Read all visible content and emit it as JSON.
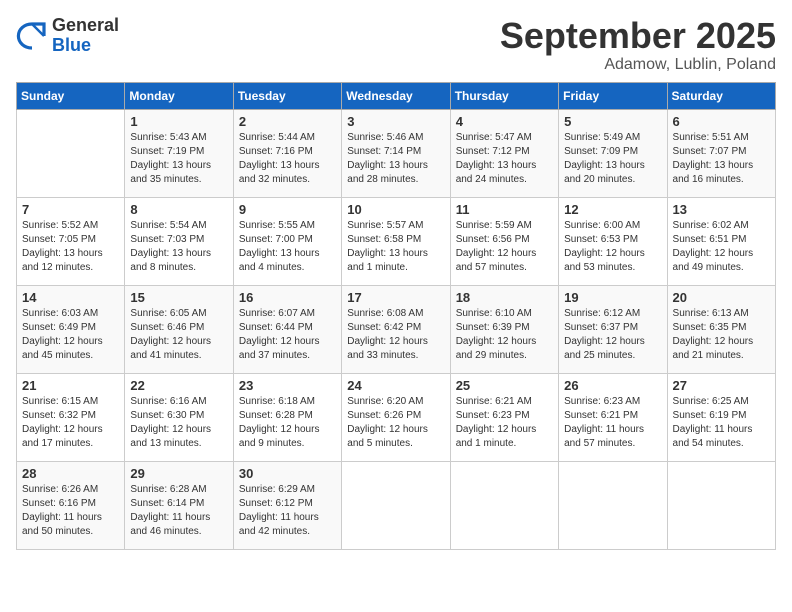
{
  "header": {
    "logo_general": "General",
    "logo_blue": "Blue",
    "month": "September 2025",
    "location": "Adamow, Lublin, Poland"
  },
  "days_of_week": [
    "Sunday",
    "Monday",
    "Tuesday",
    "Wednesday",
    "Thursday",
    "Friday",
    "Saturday"
  ],
  "weeks": [
    [
      {
        "num": "",
        "info": ""
      },
      {
        "num": "1",
        "info": "Sunrise: 5:43 AM\nSunset: 7:19 PM\nDaylight: 13 hours\nand 35 minutes."
      },
      {
        "num": "2",
        "info": "Sunrise: 5:44 AM\nSunset: 7:16 PM\nDaylight: 13 hours\nand 32 minutes."
      },
      {
        "num": "3",
        "info": "Sunrise: 5:46 AM\nSunset: 7:14 PM\nDaylight: 13 hours\nand 28 minutes."
      },
      {
        "num": "4",
        "info": "Sunrise: 5:47 AM\nSunset: 7:12 PM\nDaylight: 13 hours\nand 24 minutes."
      },
      {
        "num": "5",
        "info": "Sunrise: 5:49 AM\nSunset: 7:09 PM\nDaylight: 13 hours\nand 20 minutes."
      },
      {
        "num": "6",
        "info": "Sunrise: 5:51 AM\nSunset: 7:07 PM\nDaylight: 13 hours\nand 16 minutes."
      }
    ],
    [
      {
        "num": "7",
        "info": "Sunrise: 5:52 AM\nSunset: 7:05 PM\nDaylight: 13 hours\nand 12 minutes."
      },
      {
        "num": "8",
        "info": "Sunrise: 5:54 AM\nSunset: 7:03 PM\nDaylight: 13 hours\nand 8 minutes."
      },
      {
        "num": "9",
        "info": "Sunrise: 5:55 AM\nSunset: 7:00 PM\nDaylight: 13 hours\nand 4 minutes."
      },
      {
        "num": "10",
        "info": "Sunrise: 5:57 AM\nSunset: 6:58 PM\nDaylight: 13 hours\nand 1 minute."
      },
      {
        "num": "11",
        "info": "Sunrise: 5:59 AM\nSunset: 6:56 PM\nDaylight: 12 hours\nand 57 minutes."
      },
      {
        "num": "12",
        "info": "Sunrise: 6:00 AM\nSunset: 6:53 PM\nDaylight: 12 hours\nand 53 minutes."
      },
      {
        "num": "13",
        "info": "Sunrise: 6:02 AM\nSunset: 6:51 PM\nDaylight: 12 hours\nand 49 minutes."
      }
    ],
    [
      {
        "num": "14",
        "info": "Sunrise: 6:03 AM\nSunset: 6:49 PM\nDaylight: 12 hours\nand 45 minutes."
      },
      {
        "num": "15",
        "info": "Sunrise: 6:05 AM\nSunset: 6:46 PM\nDaylight: 12 hours\nand 41 minutes."
      },
      {
        "num": "16",
        "info": "Sunrise: 6:07 AM\nSunset: 6:44 PM\nDaylight: 12 hours\nand 37 minutes."
      },
      {
        "num": "17",
        "info": "Sunrise: 6:08 AM\nSunset: 6:42 PM\nDaylight: 12 hours\nand 33 minutes."
      },
      {
        "num": "18",
        "info": "Sunrise: 6:10 AM\nSunset: 6:39 PM\nDaylight: 12 hours\nand 29 minutes."
      },
      {
        "num": "19",
        "info": "Sunrise: 6:12 AM\nSunset: 6:37 PM\nDaylight: 12 hours\nand 25 minutes."
      },
      {
        "num": "20",
        "info": "Sunrise: 6:13 AM\nSunset: 6:35 PM\nDaylight: 12 hours\nand 21 minutes."
      }
    ],
    [
      {
        "num": "21",
        "info": "Sunrise: 6:15 AM\nSunset: 6:32 PM\nDaylight: 12 hours\nand 17 minutes."
      },
      {
        "num": "22",
        "info": "Sunrise: 6:16 AM\nSunset: 6:30 PM\nDaylight: 12 hours\nand 13 minutes."
      },
      {
        "num": "23",
        "info": "Sunrise: 6:18 AM\nSunset: 6:28 PM\nDaylight: 12 hours\nand 9 minutes."
      },
      {
        "num": "24",
        "info": "Sunrise: 6:20 AM\nSunset: 6:26 PM\nDaylight: 12 hours\nand 5 minutes."
      },
      {
        "num": "25",
        "info": "Sunrise: 6:21 AM\nSunset: 6:23 PM\nDaylight: 12 hours\nand 1 minute."
      },
      {
        "num": "26",
        "info": "Sunrise: 6:23 AM\nSunset: 6:21 PM\nDaylight: 11 hours\nand 57 minutes."
      },
      {
        "num": "27",
        "info": "Sunrise: 6:25 AM\nSunset: 6:19 PM\nDaylight: 11 hours\nand 54 minutes."
      }
    ],
    [
      {
        "num": "28",
        "info": "Sunrise: 6:26 AM\nSunset: 6:16 PM\nDaylight: 11 hours\nand 50 minutes."
      },
      {
        "num": "29",
        "info": "Sunrise: 6:28 AM\nSunset: 6:14 PM\nDaylight: 11 hours\nand 46 minutes."
      },
      {
        "num": "30",
        "info": "Sunrise: 6:29 AM\nSunset: 6:12 PM\nDaylight: 11 hours\nand 42 minutes."
      },
      {
        "num": "",
        "info": ""
      },
      {
        "num": "",
        "info": ""
      },
      {
        "num": "",
        "info": ""
      },
      {
        "num": "",
        "info": ""
      }
    ]
  ]
}
